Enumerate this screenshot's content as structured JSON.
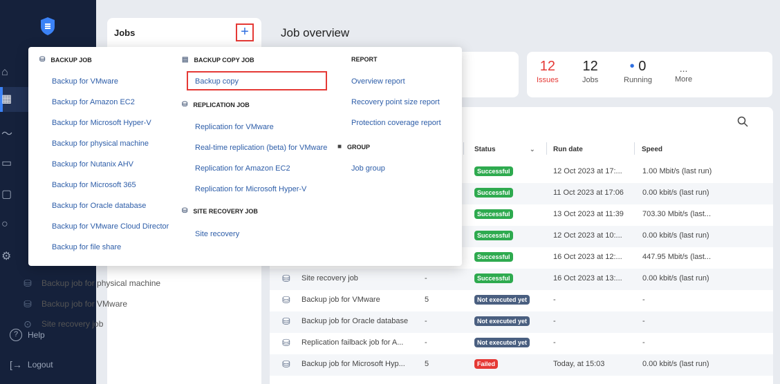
{
  "sidebar": {
    "help_label": "Help",
    "logout_label": "Logout"
  },
  "jobs_panel": {
    "title": "Jobs",
    "items": [
      {
        "label": "Backup job for physical machine",
        "icon": "backup-job-icon"
      },
      {
        "label": "Backup job for VMware",
        "icon": "backup-job-icon"
      },
      {
        "label": "Site recovery job",
        "icon": "site-recovery-icon"
      }
    ]
  },
  "main": {
    "title": "Job overview",
    "stats": {
      "issues_value": "12",
      "issues_label": "Issues",
      "jobs_value": "12",
      "jobs_label": "Jobs",
      "running_value": "0",
      "running_label": "Running",
      "more_value": "...",
      "more_label": "More"
    },
    "table": {
      "columns": [
        "Status",
        "Run date",
        "Speed"
      ],
      "rows": [
        {
          "name": "",
          "count": "",
          "status": "Successful",
          "status_type": "ok",
          "run_date": "12 Oct 2023 at 17:...",
          "speed": "1.00 Mbit/s (last run)"
        },
        {
          "name": "",
          "count": "",
          "status": "Successful",
          "status_type": "ok",
          "run_date": "11 Oct 2023 at 17:06",
          "speed": "0.00 kbit/s (last run)"
        },
        {
          "name": "",
          "count": "",
          "status": "Successful",
          "status_type": "ok",
          "run_date": "13 Oct 2023 at 11:39",
          "speed": "703.30 Mbit/s (last..."
        },
        {
          "name": "",
          "count": "",
          "status": "Successful",
          "status_type": "ok",
          "run_date": "12 Oct 2023 at 10:...",
          "speed": "0.00 kbit/s (last run)"
        },
        {
          "name": "",
          "count": "",
          "status": "Successful",
          "status_type": "ok",
          "run_date": "16 Oct 2023 at 12:...",
          "speed": "447.95 Mbit/s (last..."
        },
        {
          "name": "Site recovery job",
          "count": "-",
          "status": "Successful",
          "status_type": "ok",
          "run_date": "16 Oct 2023 at 13:...",
          "speed": "0.00 kbit/s (last run)"
        },
        {
          "name": "Backup job for VMware",
          "count": "5",
          "status": "Not executed yet",
          "status_type": "ne",
          "run_date": "-",
          "speed": "-"
        },
        {
          "name": "Backup job for Oracle database",
          "count": "-",
          "status": "Not executed yet",
          "status_type": "ne",
          "run_date": "-",
          "speed": "-"
        },
        {
          "name": "Replication failback job for A...",
          "count": "-",
          "status": "Not executed yet",
          "status_type": "ne",
          "run_date": "-",
          "speed": "-"
        },
        {
          "name": "Backup job for Microsoft Hyp...",
          "count": "5",
          "status": "Failed",
          "status_type": "fail",
          "run_date": "Today, at 15:03",
          "speed": "0.00 kbit/s (last run)"
        }
      ]
    }
  },
  "menu": {
    "backup_job": {
      "heading": "BACKUP JOB",
      "items": [
        "Backup for VMware",
        "Backup for Amazon EC2",
        "Backup for Microsoft Hyper-V",
        "Backup for physical machine",
        "Backup for Nutanix AHV",
        "Backup for Microsoft 365",
        "Backup for Oracle database",
        "Backup for VMware Cloud Director",
        "Backup for file share"
      ]
    },
    "backup_copy_job": {
      "heading": "BACKUP COPY JOB",
      "items": [
        "Backup copy"
      ]
    },
    "replication_job": {
      "heading": "REPLICATION JOB",
      "items": [
        "Replication for VMware",
        "Real-time replication (beta) for VMware",
        "Replication for Amazon EC2",
        "Replication for Microsoft Hyper-V"
      ]
    },
    "site_recovery_job": {
      "heading": "SITE RECOVERY JOB",
      "items": [
        "Site recovery"
      ]
    },
    "report": {
      "heading": "REPORT",
      "items": [
        "Overview report",
        "Recovery point size report",
        "Protection coverage report"
      ]
    },
    "group": {
      "heading": "GROUP",
      "items": [
        "Job group"
      ]
    }
  },
  "colors": {
    "sidebar_bg": "#15213b",
    "accent": "#2f6fe0",
    "issues": "#e53935",
    "success": "#2eaa4f",
    "not_executed": "#4a5f80",
    "failed": "#e53935"
  }
}
